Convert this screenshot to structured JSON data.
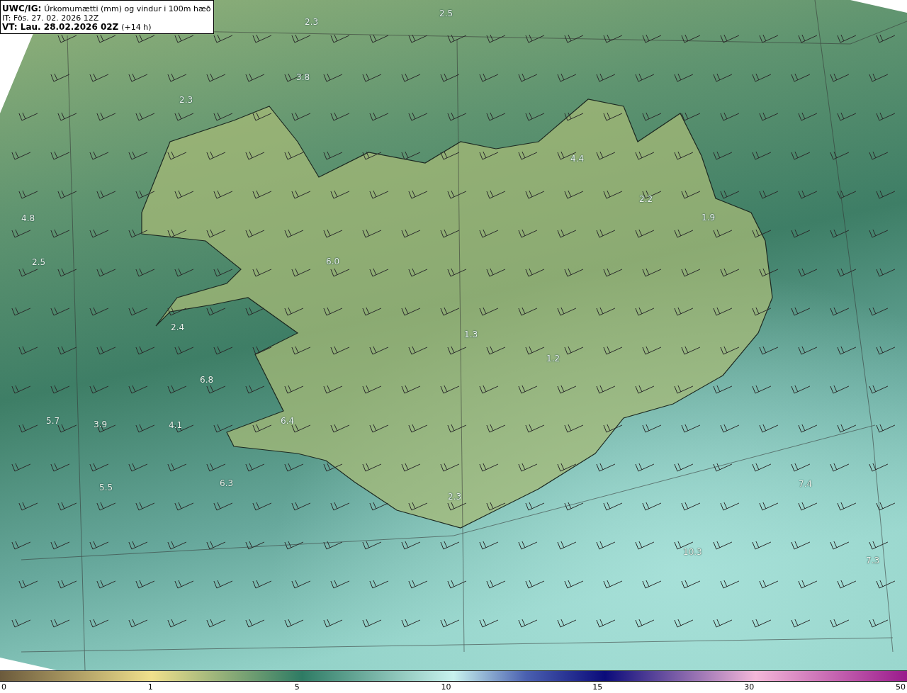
{
  "title_box": {
    "model": "UWC/IG:",
    "product": "Úrkomumætti (mm) og vindur i 100m hæð",
    "issue_time": "IT: Fös. 27. 02. 2026 12Z",
    "valid_time": "VT: Lau. 28.02.2026 02Z",
    "lead_time": "(+14 h)"
  },
  "map": {
    "value_labels": [
      "2.5",
      "2.3",
      "3.8",
      "2.3",
      "4.8",
      "2.5",
      "6.0",
      "4.4",
      "2.2",
      "1.9",
      "2.4",
      "6.8",
      "5.7",
      "3.9",
      "4.1",
      "6.4",
      "5.5",
      "6.3",
      "1.3",
      "1.2",
      "2.3",
      "7.4",
      "10.3",
      "7.3"
    ]
  },
  "colorbar": {
    "ticks": [
      "0",
      "1",
      "5",
      "10",
      "15",
      "30",
      "50"
    ]
  }
}
